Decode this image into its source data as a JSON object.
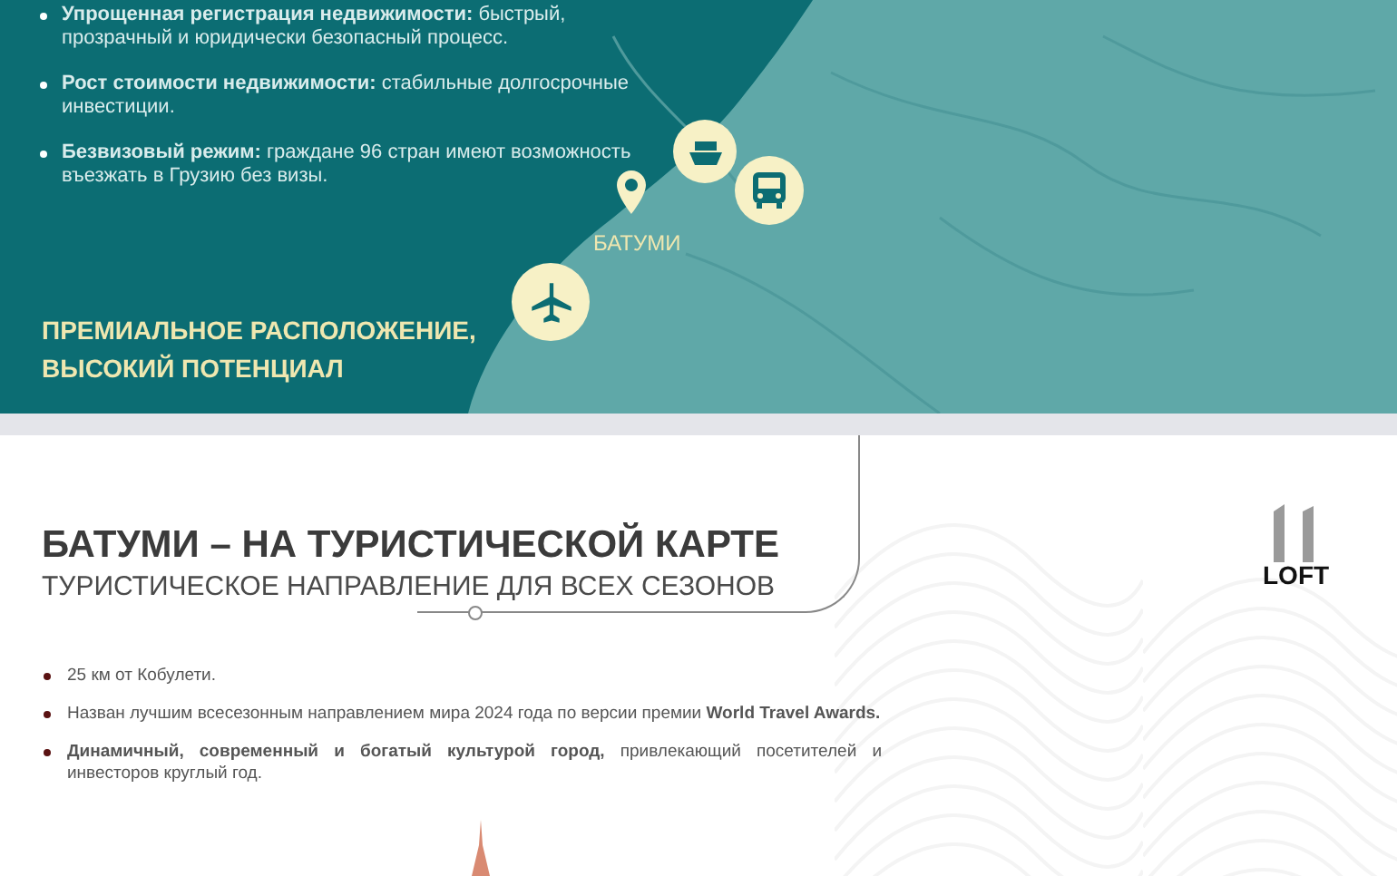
{
  "top": {
    "bullets": [
      {
        "text": "**Упрощенная регистрация недвижимости:** быстрый, прозрачный и юридически безопасный процесс."
      },
      {
        "text": "**Рост стоимости недвижимости:** стабильные долгосрочные инвестиции."
      },
      {
        "text": "**Безвизовый режим:** граждане 96 стран имеют возможность въезжать в Грузию без визы."
      }
    ],
    "heading": [
      "ПРЕМИАЛЬНОЕ РАСПОЛОЖЕНИЕ,",
      "ВЫСОКИЙ ПОТЕНЦИАЛ"
    ],
    "map": {
      "city": "БАТУМИ"
    }
  },
  "section": {
    "title": "БАТУМИ – НА ТУРИСТИЧЕСКОЙ КАРТЕ",
    "subtitle": "ТУРИСТИЧЕСКОЕ НАПРАВЛЕНИЕ ДЛЯ ВСЕХ СЕЗОНОВ",
    "logo": "LOFT",
    "bullets": [
      {
        "text": "25 км от Кобулети."
      },
      {
        "text": "Назван лучшим всесезонным направлением мира 2024 года по версии премии **World Travel Awards.**"
      },
      {
        "text": "**Динамичный, современный и богатый культурой город,** привлекающий посетителей и инвесторов круглый год."
      }
    ]
  }
}
